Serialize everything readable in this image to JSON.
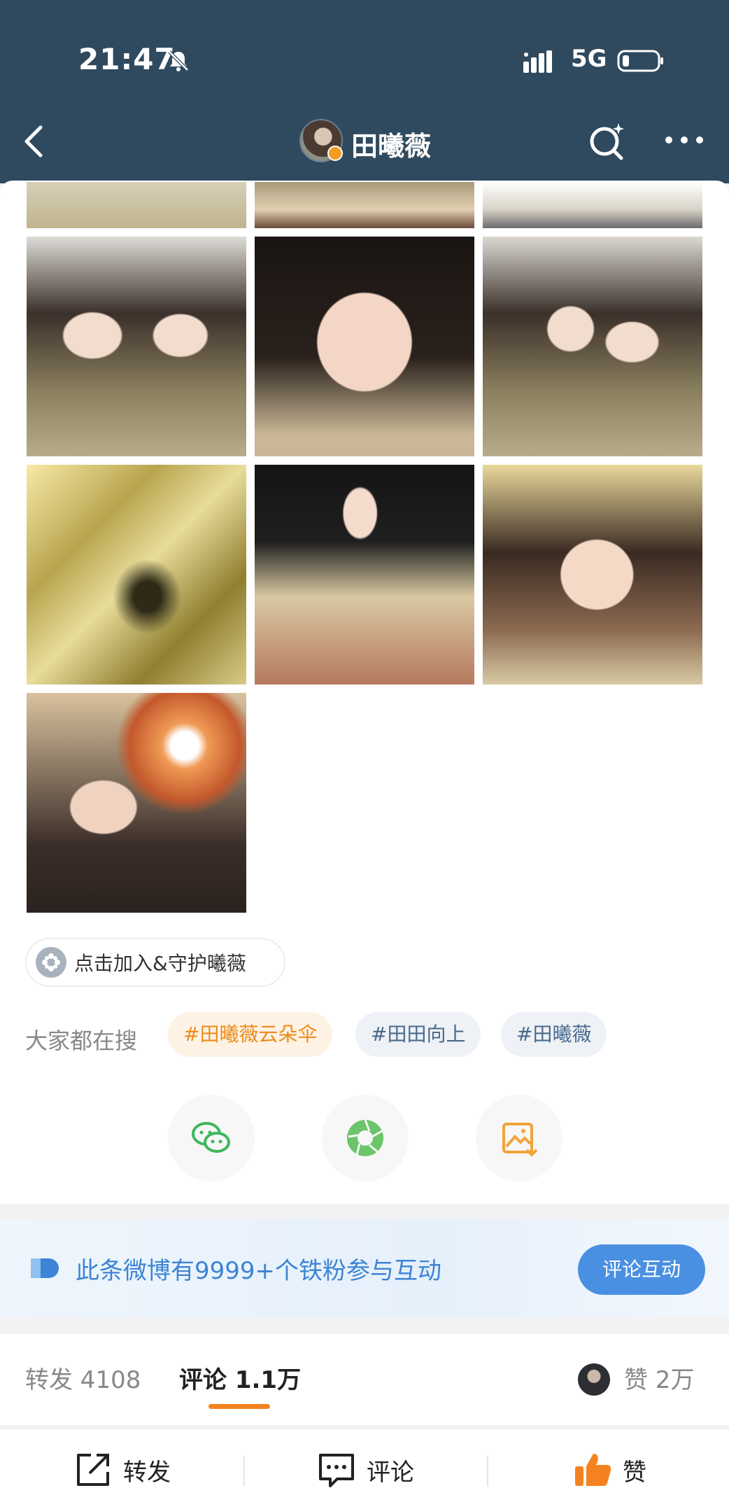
{
  "status_bar": {
    "time": "21:47",
    "network": "5G"
  },
  "header": {
    "title": "田曦薇"
  },
  "join_chip": {
    "label": "点击加入&守护曦薇"
  },
  "hot_search": {
    "label": "大家都在搜",
    "tags": [
      "#田曦薇云朵伞",
      "#田田向上",
      "#田曦薇"
    ]
  },
  "share": {
    "icons": [
      "wechat-icon",
      "moments-icon",
      "save-image-icon"
    ]
  },
  "fan_banner": {
    "text": "此条微博有9999+个铁粉参与互动",
    "button": "评论互动"
  },
  "stats": {
    "repost_label": "转发 4108",
    "comment_label": "评论 1.1万",
    "like_label": "赞 2万"
  },
  "actions": {
    "repost": "转发",
    "comment": "评论",
    "like": "赞"
  },
  "colors": {
    "header_bg": "#2f4a5f",
    "accent_orange": "#f58220",
    "accent_blue": "#4a90e2"
  }
}
